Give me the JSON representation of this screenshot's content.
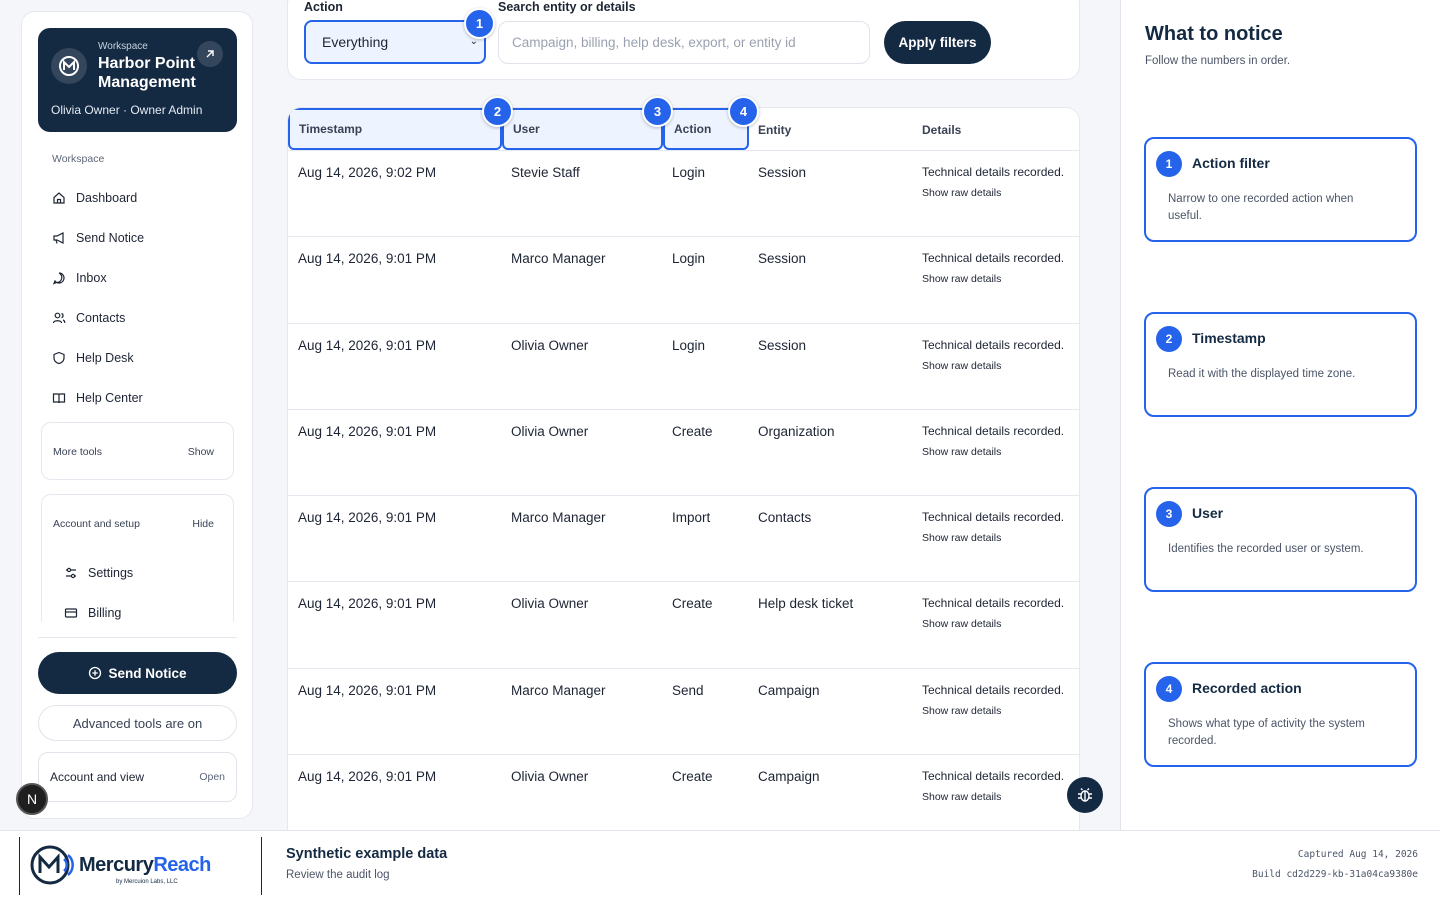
{
  "sidebar": {
    "workspace_label": "Workspace",
    "workspace_name": "Harbor Point Management",
    "user_line": "Olivia Owner · Owner Admin",
    "section_label": "Workspace",
    "items": [
      {
        "label": "Dashboard",
        "icon": "home-icon"
      },
      {
        "label": "Send Notice",
        "icon": "megaphone-icon"
      },
      {
        "label": "Inbox",
        "icon": "chat-icon"
      },
      {
        "label": "Contacts",
        "icon": "users-icon"
      },
      {
        "label": "Help Desk",
        "icon": "shield-icon"
      },
      {
        "label": "Help Center",
        "icon": "book-icon"
      }
    ],
    "more_tools": {
      "label": "More tools",
      "toggle": "Show"
    },
    "account_setup": {
      "label": "Account and setup",
      "toggle": "Hide",
      "items": [
        {
          "label": "Settings",
          "icon": "sliders-icon"
        },
        {
          "label": "Billing",
          "icon": "card-icon"
        }
      ]
    },
    "send_notice_button": "Send Notice",
    "advanced_tools": "Advanced tools are on",
    "account_view": {
      "label": "Account and view",
      "action": "Open"
    },
    "badge_letter": "N"
  },
  "filters": {
    "action_label": "Action",
    "action_value": "Everything",
    "search_label": "Search entity or details",
    "search_placeholder": "Campaign, billing, help desk, export, or entity id",
    "apply_label": "Apply filters"
  },
  "table": {
    "columns": [
      "Timestamp",
      "User",
      "Action",
      "Entity",
      "Details"
    ],
    "raw_link": "Show raw details",
    "rows": [
      {
        "timestamp": "Aug 14, 2026, 9:02 PM",
        "user": "Stevie Staff",
        "action": "Login",
        "entity": "Session",
        "details": "Technical details recorded."
      },
      {
        "timestamp": "Aug 14, 2026, 9:01 PM",
        "user": "Marco Manager",
        "action": "Login",
        "entity": "Session",
        "details": "Technical details recorded."
      },
      {
        "timestamp": "Aug 14, 2026, 9:01 PM",
        "user": "Olivia Owner",
        "action": "Login",
        "entity": "Session",
        "details": "Technical details recorded."
      },
      {
        "timestamp": "Aug 14, 2026, 9:01 PM",
        "user": "Olivia Owner",
        "action": "Create",
        "entity": "Organization",
        "details": "Technical details recorded."
      },
      {
        "timestamp": "Aug 14, 2026, 9:01 PM",
        "user": "Marco Manager",
        "action": "Import",
        "entity": "Contacts",
        "details": "Technical details recorded."
      },
      {
        "timestamp": "Aug 14, 2026, 9:01 PM",
        "user": "Olivia Owner",
        "action": "Create",
        "entity": "Help desk ticket",
        "details": "Technical details recorded."
      },
      {
        "timestamp": "Aug 14, 2026, 9:01 PM",
        "user": "Marco Manager",
        "action": "Send",
        "entity": "Campaign",
        "details": "Technical details recorded."
      },
      {
        "timestamp": "Aug 14, 2026, 9:01 PM",
        "user": "Olivia Owner",
        "action": "Create",
        "entity": "Campaign",
        "details": "Technical details recorded."
      }
    ]
  },
  "markers": [
    "1",
    "2",
    "3",
    "4"
  ],
  "guide": {
    "title": "What to notice",
    "subtitle": "Follow the numbers in order.",
    "tips": [
      {
        "num": "1",
        "title": "Action filter",
        "desc": "Narrow to one recorded action when useful."
      },
      {
        "num": "2",
        "title": "Timestamp",
        "desc": "Read it with the displayed time zone."
      },
      {
        "num": "3",
        "title": "User",
        "desc": "Identifies the recorded user or system."
      },
      {
        "num": "4",
        "title": "Recorded action",
        "desc": "Shows what type of activity the system recorded."
      }
    ]
  },
  "footer": {
    "brand_main": "Mercury",
    "brand_accent": "Reach",
    "brand_by": "by Mercuion Labs, LLC",
    "title": "Synthetic example data",
    "subtitle": "Review the audit log",
    "captured": "Captured Aug 14, 2026",
    "build": "Build cd2d229-kb-31a04ca9380e"
  },
  "colors": {
    "navy": "#142a42",
    "accent": "#2563eb"
  }
}
